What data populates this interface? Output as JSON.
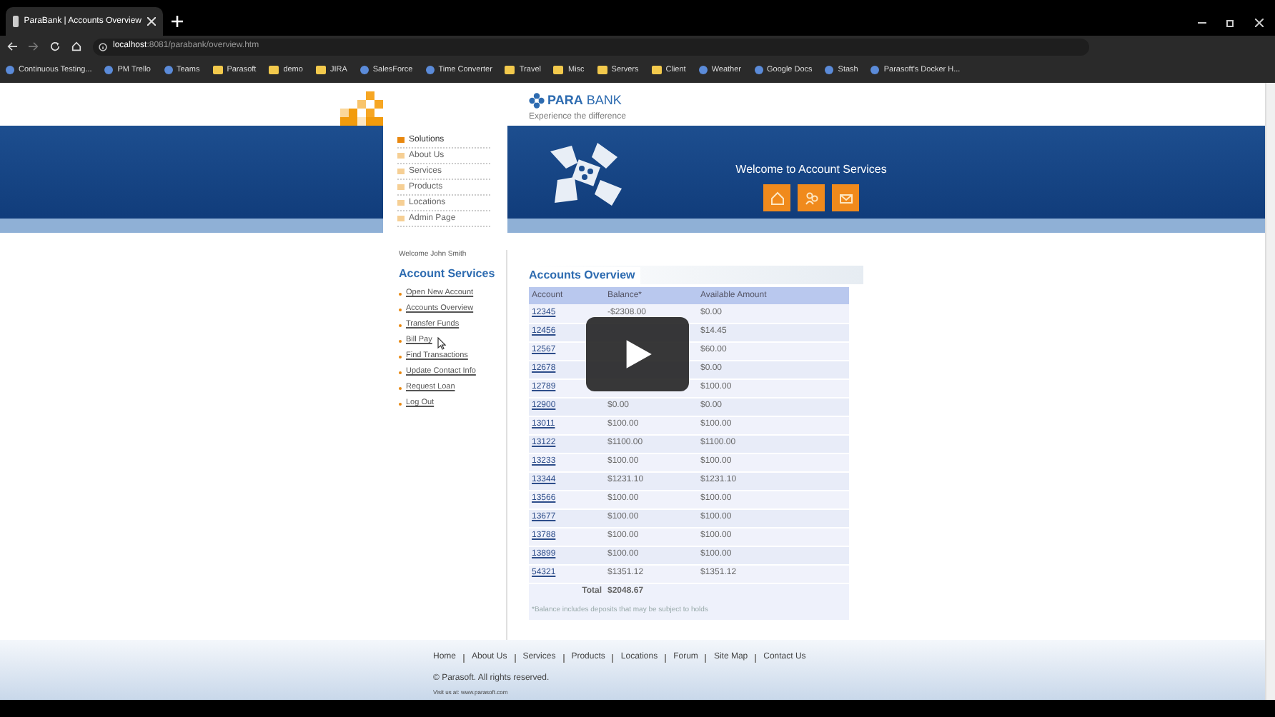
{
  "browser": {
    "tab_title": "ParaBank | Accounts Overview",
    "url_host": "localhost",
    "url_rest": ":8081/parabank/overview.htm",
    "bookmarks": [
      {
        "label": "Continuous Testing...",
        "kind": "link"
      },
      {
        "label": "PM Trello",
        "kind": "link"
      },
      {
        "label": "Teams",
        "kind": "link"
      },
      {
        "label": "Parasoft",
        "kind": "folder"
      },
      {
        "label": "demo",
        "kind": "folder"
      },
      {
        "label": "JIRA",
        "kind": "folder"
      },
      {
        "label": "SalesForce",
        "kind": "link"
      },
      {
        "label": "Time Converter",
        "kind": "link"
      },
      {
        "label": "Travel",
        "kind": "folder"
      },
      {
        "label": "Misc",
        "kind": "folder"
      },
      {
        "label": "Servers",
        "kind": "folder"
      },
      {
        "label": "Client",
        "kind": "folder"
      },
      {
        "label": "Weather",
        "kind": "link"
      },
      {
        "label": "Google Docs",
        "kind": "link"
      },
      {
        "label": "Stash",
        "kind": "link"
      },
      {
        "label": "Parasoft's Docker H...",
        "kind": "link"
      }
    ]
  },
  "header": {
    "logo": "**PARA** BANK",
    "tagline": "Experience the difference",
    "menu": [
      {
        "label": "Solutions",
        "selected": true
      },
      {
        "label": "About Us",
        "selected": false
      },
      {
        "label": "Services",
        "selected": false
      },
      {
        "label": "Products",
        "selected": false
      },
      {
        "label": "Locations",
        "selected": false
      },
      {
        "label": "Admin Page",
        "selected": false
      }
    ],
    "welcome": "Welcome to Account Services"
  },
  "sidebar": {
    "greeting": "Welcome John Smith",
    "title": "Account Services",
    "links": [
      "Open New Account",
      "Accounts Overview",
      "Transfer Funds",
      "Bill Pay",
      "Find Transactions",
      "Update Contact Info",
      "Request Loan",
      "Log Out"
    ]
  },
  "overview": {
    "title": "Accounts Overview",
    "columns": [
      "Account",
      "Balance*",
      "Available Amount"
    ],
    "rows": [
      {
        "account": "12345",
        "balance": "-$2308.00",
        "available": "$0.00"
      },
      {
        "account": "12456",
        "available": "$14.45"
      },
      {
        "account": "12567",
        "available": "$60.00"
      },
      {
        "account": "12678",
        "available": "$0.00"
      },
      {
        "account": "12789",
        "available": "$100.00"
      },
      {
        "account": "12900",
        "balance": "$0.00",
        "available": "$0.00"
      },
      {
        "account": "13011",
        "balance": "$100.00",
        "available": "$100.00"
      },
      {
        "account": "13122",
        "balance": "$1100.00",
        "available": "$1100.00"
      },
      {
        "account": "13233",
        "balance": "$100.00",
        "available": "$100.00"
      },
      {
        "account": "13344",
        "balance": "$1231.10",
        "available": "$1231.10"
      },
      {
        "account": "13566",
        "balance": "$100.00",
        "available": "$100.00"
      },
      {
        "account": "13677",
        "balance": "$100.00",
        "available": "$100.00"
      },
      {
        "account": "13788",
        "balance": "$100.00",
        "available": "$100.00"
      },
      {
        "account": "13899",
        "balance": "$100.00",
        "available": "$100.00"
      },
      {
        "account": "54321",
        "balance": "$1351.12",
        "available": "$1351.12"
      }
    ],
    "total_label": "Total",
    "total": "$2048.67",
    "note": "*Balance includes deposits that may be subject to holds"
  },
  "footer": {
    "links": [
      "Home",
      "About Us",
      "Services",
      "Products",
      "Locations",
      "Forum",
      "Site Map",
      "Contact Us"
    ],
    "copyright": "© Parasoft. All rights reserved.",
    "visit": "Visit us at: www.parasoft.com"
  }
}
